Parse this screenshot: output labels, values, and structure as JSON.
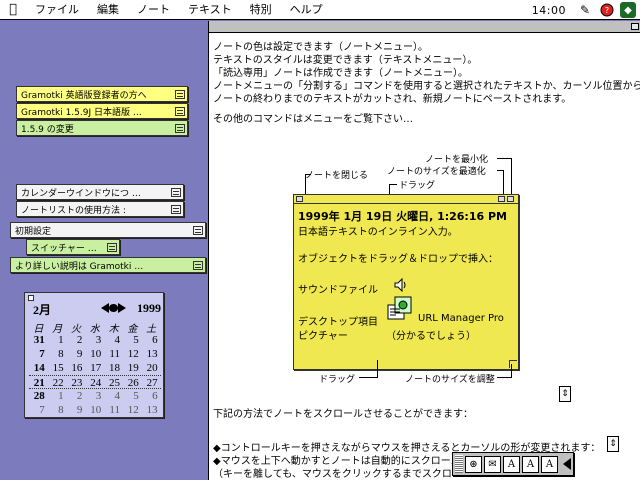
{
  "menubar": {
    "items": [
      "ファイル",
      "編集",
      "ノート",
      "テキスト",
      "特別",
      "ヘルプ"
    ],
    "clock": "14:00"
  },
  "desktop_notes": [
    {
      "label": "Gramotki 英語版登録者の方へ"
    },
    {
      "label": "Gramotki 1.5.9J 日本語版 …"
    },
    {
      "label": "1.5.9 の変更"
    },
    {
      "label": "カレンダーウインドウにつ …"
    },
    {
      "label": "ノートリストの使用方法 :"
    },
    {
      "label": "初期設定"
    },
    {
      "label": "スイッチャー …"
    },
    {
      "label": "より詳しい説明は Gramotki …"
    }
  ],
  "calendar": {
    "month": "2月",
    "year": "1999",
    "weekdays": [
      "日",
      "月",
      "火",
      "水",
      "木",
      "金",
      "土"
    ],
    "weeks": [
      [
        "31",
        "1",
        "2",
        "3",
        "4",
        "5",
        "6"
      ],
      [
        "7",
        "8",
        "9",
        "10",
        "11",
        "12",
        "13"
      ],
      [
        "14",
        "15",
        "16",
        "17",
        "18",
        "19",
        "20"
      ],
      [
        "21",
        "22",
        "23",
        "24",
        "25",
        "26",
        "27"
      ],
      [
        "28",
        "1",
        "2",
        "3",
        "4",
        "5",
        "6"
      ],
      [
        "7",
        "8",
        "9",
        "10",
        "11",
        "12",
        "13"
      ]
    ]
  },
  "content": {
    "lines": [
      "ノートの色は設定できます（ノートメニュー）。",
      "テキストのスタイルは変更できます（テキストメニュー）。",
      "「読込専用」ノートは作成できます（ノートメニュー）。",
      "ノートメニューの「分割する」コマンドを使用すると選択されたテキストか、カーソル位置から",
      "ノートの終わりまでのテキストがカットされ、新規ノートにペーストされます。"
    ],
    "other_commands": "その他のコマンドはメニューをご覧下さい…",
    "scroll_intro": "下記の方法でノートをスクロールさせることができます：",
    "bullet1": "◆コントロールキーを押さえながらマウスを押さえるとカーソルの形が変更されます：",
    "bullet2": "◆マウスを上下へ動かすとノートは自動的にスクロールします",
    "bullet3": "（キーを離しても、マウスをクリックするまでスクロール"
  },
  "diagram": {
    "labels": {
      "minimize": "ノートを最小化",
      "optimize": "ノートのサイズを最適化",
      "close": "ノートを閉じる",
      "drag_top": "ドラッグ",
      "drag_bottom": "ドラッグ",
      "resize": "ノートのサイズを調整"
    },
    "note": {
      "date": "1999年 1月 19日 火曜日, 1:26:16 PM",
      "line1": "日本語テキストのインライン入力。",
      "line2": "オブジェクトをドラッグ＆ドロップで挿入：",
      "sound": "サウンドファイル",
      "desktop": "デスクトップ項目",
      "picture": "ピクチャー",
      "url": "URL Manager Pro",
      "understand": "（分かるでしょう）"
    }
  },
  "palette": {
    "buttons": [
      "A",
      "A",
      "A"
    ]
  }
}
